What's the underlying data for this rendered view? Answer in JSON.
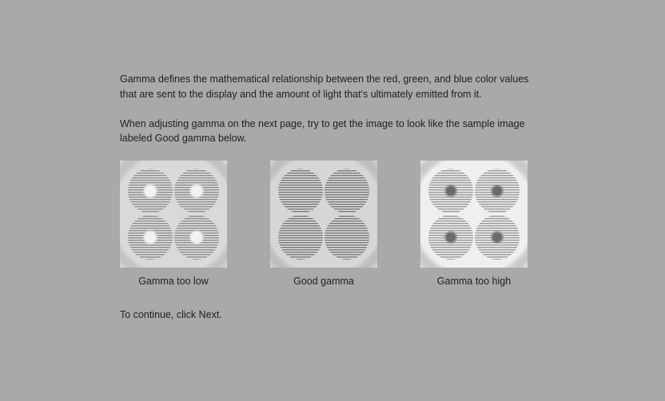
{
  "intro_para": "Gamma defines the mathematical relationship between the red, green, and blue color values that are sent to the display and the amount of light that's ultimately emitted from it.",
  "instruction_para": "When adjusting gamma on the next page, try to get the image to look like the sample image labeled Good gamma below.",
  "samples": {
    "low_caption": "Gamma too low",
    "good_caption": "Good gamma",
    "high_caption": "Gamma too high"
  },
  "continue_text": "To continue, click Next."
}
